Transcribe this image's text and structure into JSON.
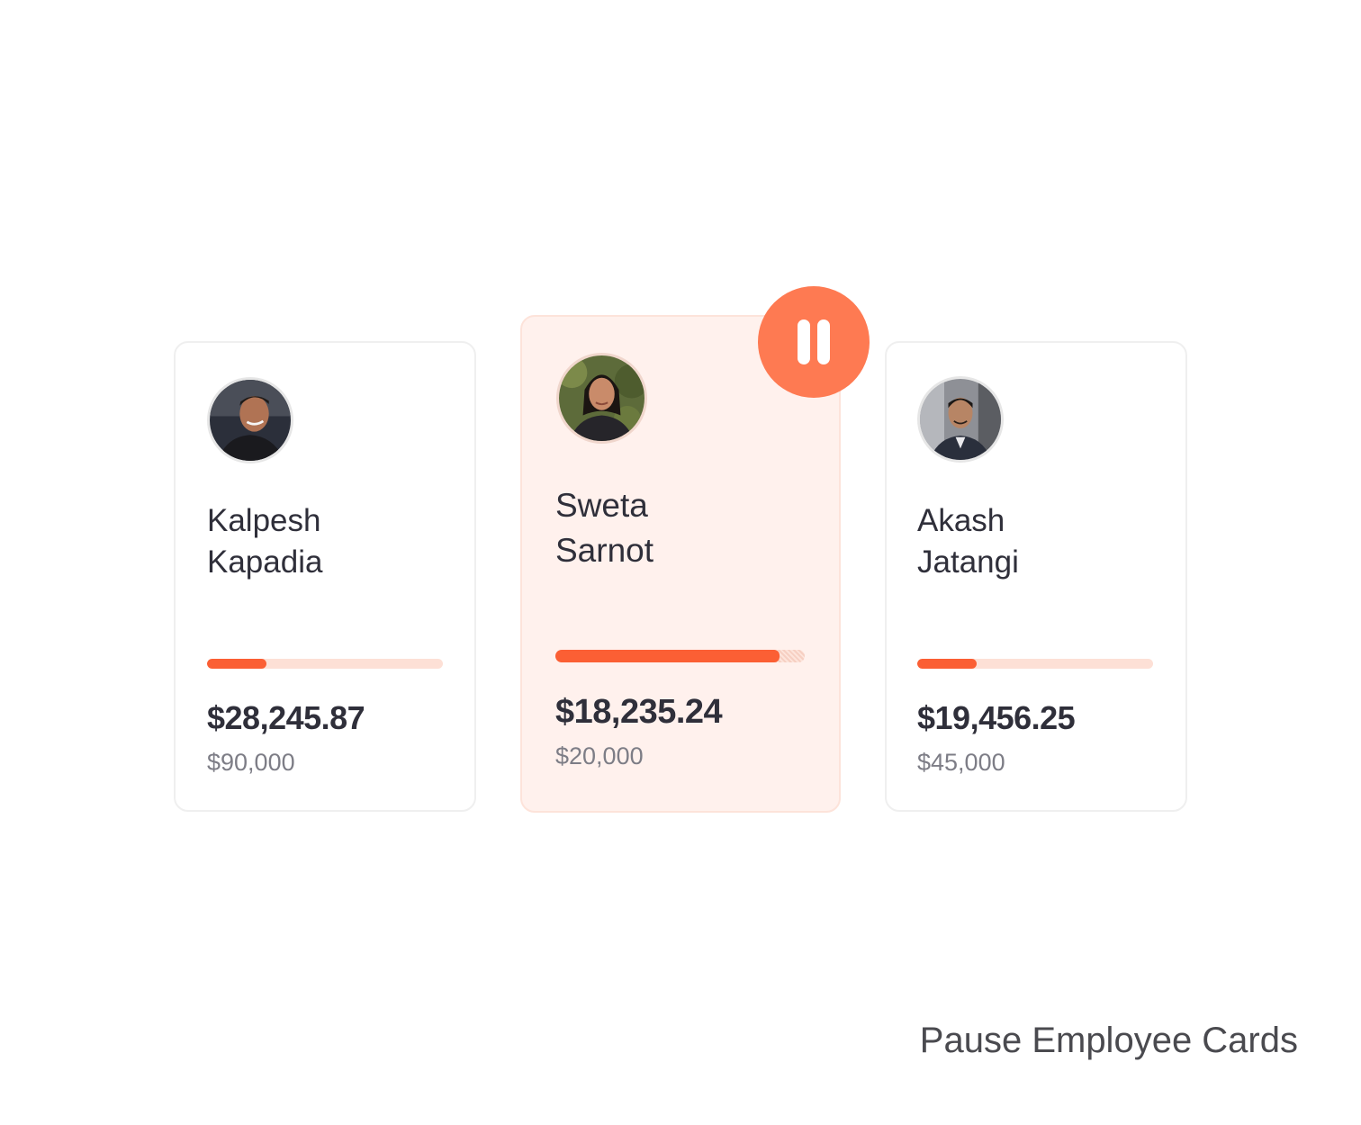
{
  "cards": [
    {
      "first_name": "Kalpesh",
      "last_name": "Kapadia",
      "amount": "$28,245.87",
      "budget": "$90,000",
      "progress": 0.25,
      "paused": false
    },
    {
      "first_name": "Sweta",
      "last_name": "Sarnot",
      "amount": "$18,235.24",
      "budget": "$20,000",
      "progress": 0.9,
      "paused": true
    },
    {
      "first_name": "Akash",
      "last_name": "Jatangi",
      "amount": "$19,456.25",
      "budget": "$45,000",
      "progress": 0.25,
      "paused": false
    }
  ],
  "pause_button": {
    "icon": "pause-icon"
  },
  "caption": "Pause Employee Cards",
  "colors": {
    "accent": "#fb5f34",
    "pause_button": "#fe7a52",
    "paused_card_bg": "#fff1ed",
    "progress_track": "#fde0d6",
    "text_primary": "#2f2f3a",
    "text_secondary": "#7d7d86"
  }
}
